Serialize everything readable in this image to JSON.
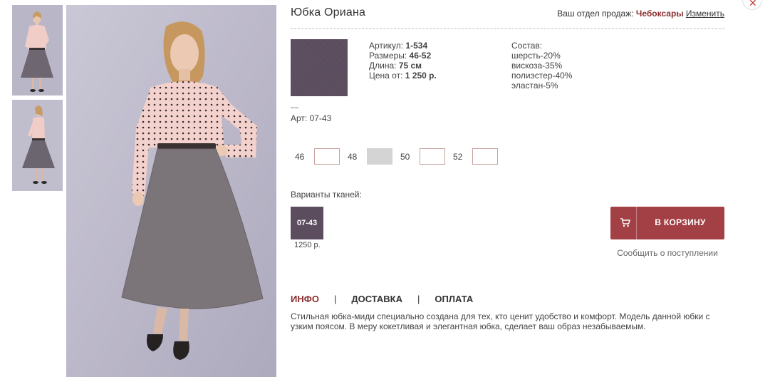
{
  "product": {
    "title": "Юбка Ориана"
  },
  "region": {
    "label": "Ваш отдел продаж:",
    "city": "Чебоксары",
    "change_label": "Изменить"
  },
  "specs": {
    "article_label": "Артикул:",
    "article_value": "1-534",
    "sizes_label": "Размеры:",
    "sizes_value": "46-52",
    "length_label": "Длина:",
    "length_value": "75 см",
    "price_label": "Цена от:",
    "price_value": "1 250 р."
  },
  "composition": {
    "label": "Состав:",
    "items": [
      "шерсть-20%",
      "вискоза-35%",
      "полиэстер-40%",
      "эластан-5%"
    ]
  },
  "fabric": {
    "dashes": "---",
    "art": "Арт: 07-43",
    "color": "#5b4d5e"
  },
  "sizes": [
    {
      "label": "46",
      "available": true
    },
    {
      "label": "48",
      "available": false
    },
    {
      "label": "50",
      "available": true
    },
    {
      "label": "52",
      "available": true
    }
  ],
  "variants": {
    "label": "Варианты тканей:",
    "items": [
      {
        "code": "07-43",
        "price": "1250 р."
      }
    ]
  },
  "cart": {
    "button_label": "В КОРЗИНУ",
    "icon": "cart-icon",
    "notify_label": "Сообщить о поступлении",
    "color": "#a34045"
  },
  "tabs": [
    {
      "label": "ИНФО",
      "active": true
    },
    {
      "label": "ДОСТАВКА",
      "active": false
    },
    {
      "label": "ОПЛАТА",
      "active": false
    }
  ],
  "tab_separator": "|",
  "description": "Стильная юбка-миди специально создана для тех, кто ценит удобство и комфорт. Модель данной юбки с узким поясом. В меру кокетливая и элегантная юбка, сделает ваш образ незабываемым.",
  "close_icon": "close-icon",
  "colors": {
    "accent": "#8a2e2e",
    "background": "#ffffff"
  }
}
